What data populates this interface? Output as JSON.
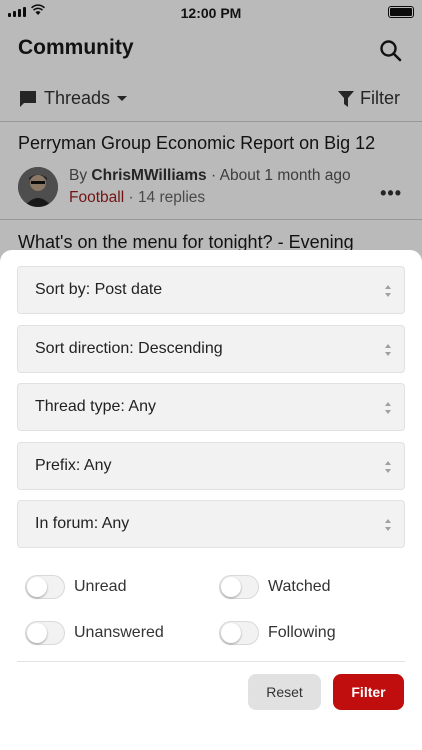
{
  "status_bar": {
    "time": "12:00 PM"
  },
  "header": {
    "title": "Community"
  },
  "toolbar": {
    "threads_label": "Threads",
    "filter_label": "Filter"
  },
  "threads": [
    {
      "title": "Perryman Group Economic Report on Big 12",
      "by": "By",
      "author": "ChrisMWilliams",
      "time": "About 1 month ago",
      "forum": "Football",
      "replies": "14 replies"
    },
    {
      "title": "What's on the menu for tonight? - Evening"
    }
  ],
  "sheet": {
    "selects": [
      {
        "label": "Sort by: Post date"
      },
      {
        "label": "Sort direction: Descending"
      },
      {
        "label": "Thread type: Any"
      },
      {
        "label": "Prefix: Any"
      },
      {
        "label": "In forum: Any"
      }
    ],
    "toggles": [
      {
        "label": "Unread",
        "on": false
      },
      {
        "label": "Watched",
        "on": false
      },
      {
        "label": "Unanswered",
        "on": false
      },
      {
        "label": "Following",
        "on": false
      }
    ],
    "reset_label": "Reset",
    "filter_label": "Filter"
  },
  "colors": {
    "accent": "#c00d0d",
    "forum_link": "#9b1c1c"
  }
}
